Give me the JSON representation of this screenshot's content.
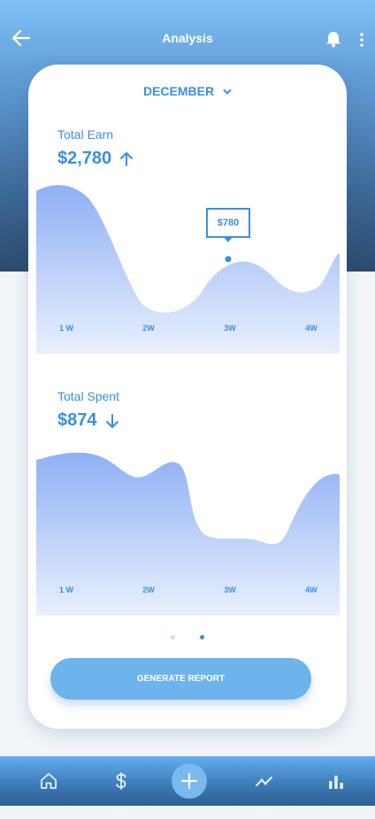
{
  "header": {
    "title": "Analysis",
    "back_icon": "arrow-left-icon",
    "bell_icon": "bell-icon",
    "more_icon": "more-vertical-icon"
  },
  "month_selector": {
    "label": "DECEMBER",
    "icon": "chevron-down-icon"
  },
  "earn": {
    "label": "Total Earn",
    "amount": "$2,780",
    "trend_icon": "arrow-up-icon",
    "tooltip": "$780",
    "ticks": [
      "1 W",
      "2W",
      "3W",
      "4W"
    ]
  },
  "spent": {
    "label": "Total Spent",
    "amount": "$874",
    "trend_icon": "arrow-down-icon",
    "ticks": [
      "1 W",
      "2W",
      "3W",
      "4W"
    ]
  },
  "pager": {
    "count": 2,
    "active_index": 1
  },
  "generate_button": {
    "label": "GENERATE REPORT"
  },
  "bottom_nav": {
    "items": [
      "home-icon",
      "dollar-icon",
      "plus-icon",
      "trend-icon",
      "bar-chart-icon"
    ],
    "active": "plus-icon"
  },
  "colors": {
    "accent": "#3a8fe0",
    "button": "#6db3ec",
    "chart_fill_top": "#8fb0f5",
    "chart_fill_bottom": "#e9f0fd"
  }
}
